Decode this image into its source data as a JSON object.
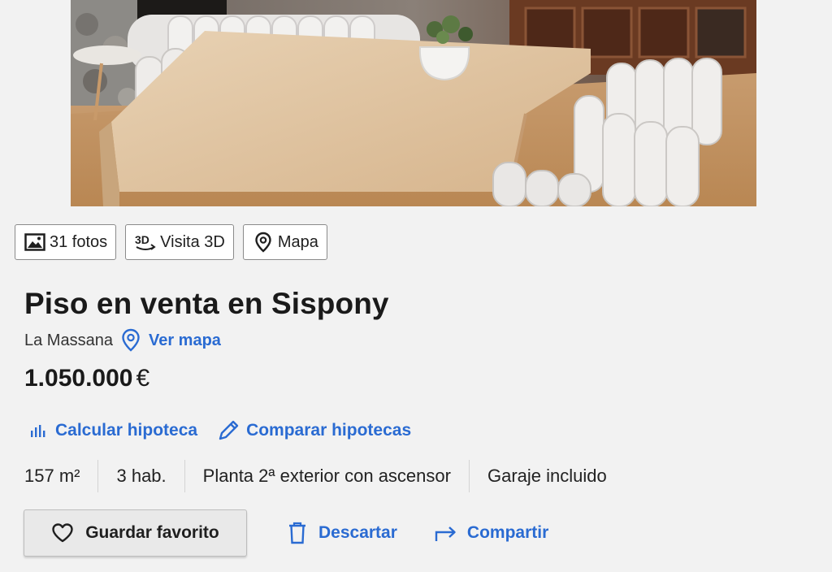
{
  "toolbar": {
    "photos_label": "31 fotos",
    "tour_label": "Visita 3D",
    "map_label": "Mapa"
  },
  "listing": {
    "title": "Piso en venta en Sispony",
    "city": "La Massana",
    "map_link": "Ver mapa",
    "price": "1.050.000",
    "currency": "€"
  },
  "mortgage": {
    "calculate_label": "Calcular hipoteca",
    "compare_label": "Comparar hipotecas"
  },
  "features": [
    "157 m²",
    "3 hab.",
    "Planta 2ª exterior con ascensor",
    "Garaje incluido"
  ],
  "actions": {
    "favorite_label": "Guardar favorito",
    "discard_label": "Descartar",
    "share_label": "Compartir"
  },
  "colors": {
    "link_blue": "#2a6bd2",
    "page_bg": "#f2f2f2",
    "text": "#1f1f1f"
  },
  "icons": {
    "photos": "image-icon",
    "tour": "3d-tour-icon",
    "map": "map-pin-icon",
    "location": "map-pin-icon",
    "calculate": "bar-chart-icon",
    "compare": "pencil-icon",
    "favorite": "heart-icon",
    "discard": "trash-icon",
    "share": "share-arrow-icon"
  }
}
